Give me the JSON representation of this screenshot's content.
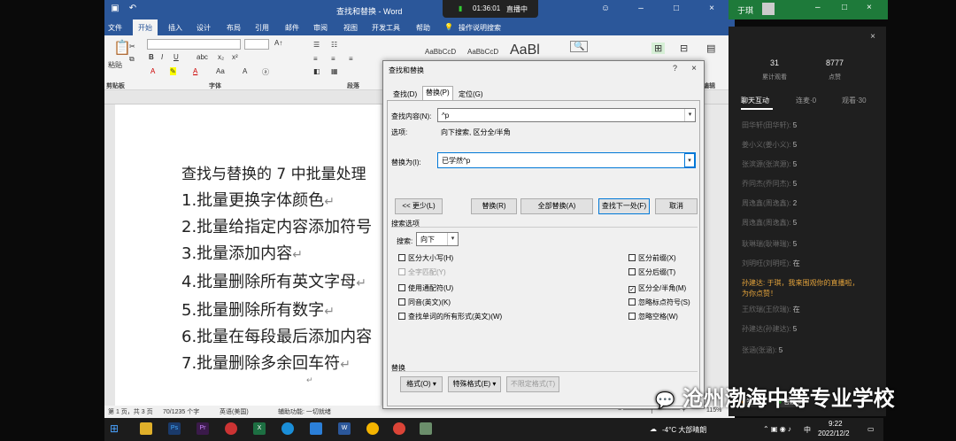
{
  "word": {
    "title": "查找和替换 - Word",
    "tabs": [
      "文件",
      "开始",
      "插入",
      "设计",
      "布局",
      "引用",
      "邮件",
      "审阅",
      "视图",
      "开发工具",
      "帮助",
      "操作说明搜索"
    ],
    "active_tab": "开始",
    "ribbon": {
      "paste": "粘贴",
      "clipboard": "剪贴板",
      "font_group": "字体",
      "para_group": "段落",
      "style1": "AaBbCcD",
      "style2": "AaBbCcD",
      "style3": "AaBl",
      "replace_group": "编辑",
      "format_label": "格式",
      "edit_label": "编辑"
    },
    "doc_lines": [
      "查找与替换的 7 中批量处理",
      "1.批量更换字体颜色",
      "2.批量给指定内容添加符号",
      "3.批量添加内容",
      "4.批量删除所有英文字母",
      "5.批量删除所有数字",
      "6.批量在每段最后添加内容",
      "7.批量删除多余回车符"
    ],
    "return_mark": "↵",
    "status": {
      "page": "第 1 页，共 3 页",
      "words": "70/1235 个字",
      "lang": "英语(美国)",
      "accessibility": "辅助功能: 一切就绪",
      "zoom": "115%"
    }
  },
  "dialog": {
    "title": "查找和替换",
    "help": "?",
    "close": "×",
    "tabs": [
      "查找(D)",
      "替换(P)",
      "定位(G)"
    ],
    "active_tab": "替换(P)",
    "find_label": "查找内容(N):",
    "find_value": "^p",
    "options_label": "选项:",
    "options_value": "向下搜索, 区分全/半角",
    "replace_label": "替换为(I):",
    "replace_value": "已学然^p",
    "buttons": {
      "less": "<< 更少(L)",
      "replace": "替换(R)",
      "replace_all": "全部替换(A)",
      "find_next": "查找下一处(F)",
      "cancel": "取消"
    },
    "search_options": "搜索选项",
    "search_label": "搜索:",
    "search_value": "向下",
    "left_checks": [
      {
        "label": "区分大小写(H)",
        "checked": false,
        "disabled": false
      },
      {
        "label": "全字匹配(Y)",
        "checked": false,
        "disabled": true
      },
      {
        "label": "使用通配符(U)",
        "checked": false,
        "disabled": false
      },
      {
        "label": "同音(英文)(K)",
        "checked": false,
        "disabled": false
      },
      {
        "label": "查找单词的所有形式(英文)(W)",
        "checked": false,
        "disabled": false
      }
    ],
    "right_checks": [
      {
        "label": "区分前缀(X)",
        "checked": false
      },
      {
        "label": "区分后缀(T)",
        "checked": false
      },
      {
        "label": "区分全/半角(M)",
        "checked": true
      },
      {
        "label": "忽略标点符号(S)",
        "checked": false
      },
      {
        "label": "忽略空格(W)",
        "checked": false
      }
    ],
    "replace_section": "替换",
    "bottom_buttons": {
      "format": "格式(O) ▾",
      "special": "特殊格式(E) ▾",
      "no_format": "不限定格式(T)"
    }
  },
  "live": {
    "timer": "01:36:01",
    "status": "直播中"
  },
  "chat": {
    "user": "于琪",
    "stats": [
      {
        "value": "31",
        "label": "累计观看"
      },
      {
        "value": "8777",
        "label": "点赞"
      }
    ],
    "tabs": [
      "聊天互动",
      "连麦·0",
      "观看·30"
    ],
    "messages": [
      {
        "name": "田华轩(田华轩):",
        "text": "5",
        "hl": false
      },
      {
        "name": "姜小义(姜小义):",
        "text": "5",
        "hl": false
      },
      {
        "name": "张滨源(张滨源):",
        "text": "5",
        "hl": false
      },
      {
        "name": "乔同杰(乔同杰):",
        "text": "5",
        "hl": false
      },
      {
        "name": "周逸鑫(周逸鑫):",
        "text": "2",
        "hl": false
      },
      {
        "name": "周逸鑫(周逸鑫):",
        "text": "5",
        "hl": false
      },
      {
        "name": "耿琳瑞(耿琳瑞):",
        "text": "5",
        "hl": false
      },
      {
        "name": "刘明旺(刘明旺):",
        "text": "在",
        "hl": false
      },
      {
        "name": "孙建达:",
        "text": "于琪，我来围观你的直播啦，为你点赞！",
        "hl": true
      },
      {
        "name": "王欣瑞(王欣瑞):",
        "text": "在",
        "hl": false
      },
      {
        "name": "孙建达(孙建达):",
        "text": "5",
        "hl": false
      },
      {
        "name": "张涵(张涵):",
        "text": "5",
        "hl": false
      }
    ],
    "pills": [
      "签到",
      "答题卡"
    ]
  },
  "taskbar": {
    "weather": "-4°C 大部晴朗",
    "ime": "中",
    "time": "9:22",
    "date": "2022/12/2"
  },
  "watermark": "沧州渤海中等专业学校",
  "colors": {
    "word_blue": "#2b579a",
    "live_green": "#1e7a3a",
    "highlight": "#e2a23b"
  }
}
